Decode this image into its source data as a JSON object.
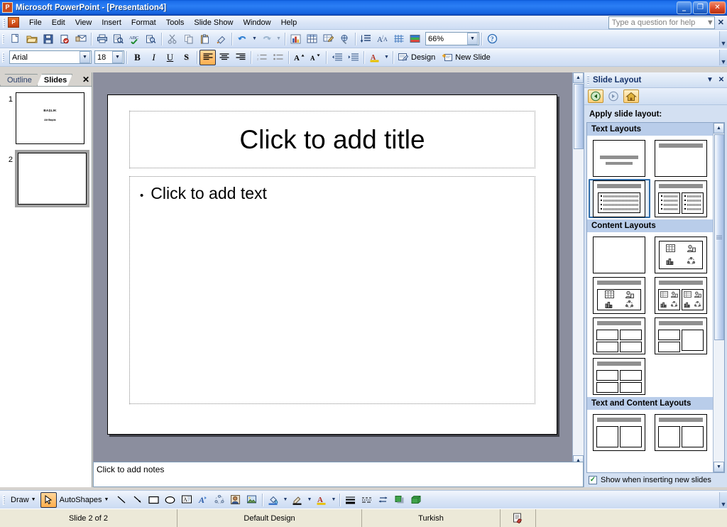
{
  "window": {
    "title": "Microsoft PowerPoint - [Presentation4]",
    "app_icon": "powerpoint-icon",
    "minimize": "_",
    "restore": "❐",
    "close": "✕"
  },
  "menubar": {
    "items": [
      {
        "label": "File"
      },
      {
        "label": "Edit"
      },
      {
        "label": "View"
      },
      {
        "label": "Insert"
      },
      {
        "label": "Format"
      },
      {
        "label": "Tools"
      },
      {
        "label": "Slide Show"
      },
      {
        "label": "Window"
      },
      {
        "label": "Help"
      }
    ]
  },
  "help_box": {
    "placeholder": "Type a question for help",
    "close": "✕"
  },
  "standard_toolbar": {
    "buttons": [
      {
        "name": "new-icon"
      },
      {
        "name": "open-icon"
      },
      {
        "name": "save-icon"
      },
      {
        "name": "permission-icon"
      },
      {
        "name": "email-icon"
      },
      {
        "name": "print-icon"
      },
      {
        "name": "print-preview-icon"
      },
      {
        "name": "spelling-icon"
      },
      {
        "name": "research-icon"
      },
      {
        "name": "cut-icon"
      },
      {
        "name": "copy-icon"
      },
      {
        "name": "paste-icon"
      },
      {
        "name": "format-painter-icon"
      },
      {
        "name": "undo-icon"
      },
      {
        "name": "redo-icon"
      },
      {
        "name": "insert-chart-icon"
      },
      {
        "name": "insert-table-icon"
      },
      {
        "name": "tables-and-borders-icon"
      },
      {
        "name": "insert-hyperlink-icon"
      },
      {
        "name": "expand-all-icon"
      },
      {
        "name": "show-formatting-icon"
      },
      {
        "name": "show-grid-icon"
      },
      {
        "name": "color-scheme-icon"
      }
    ],
    "zoom_value": "66%",
    "help_icon": "help-icon"
  },
  "formatting_toolbar": {
    "font_name": "Arial",
    "font_size": "18",
    "bold": "B",
    "italic": "I",
    "underline": "U",
    "shadow": "S",
    "align_left_active": true,
    "design_label": "Design",
    "new_slide_label": "New Slide"
  },
  "slide_panel": {
    "tabs": [
      {
        "label": "Outline",
        "selected": false
      },
      {
        "label": "Slides",
        "selected": true
      }
    ],
    "close": "✕",
    "slides": [
      {
        "number": "1",
        "selected": false,
        "title": "BAŞLIK",
        "subtitle": "Alt Başlık"
      },
      {
        "number": "2",
        "selected": true,
        "title": "",
        "subtitle": ""
      }
    ]
  },
  "slide_editor": {
    "title_placeholder": "Click to add title",
    "body_bullet": "•",
    "body_placeholder": "Click to add text"
  },
  "notes_pane": {
    "placeholder": "Click to add notes"
  },
  "task_pane": {
    "title": "Slide Layout",
    "dropdown_icon": "chevron-down-icon",
    "close": "✕",
    "nav": {
      "back": "back-icon",
      "forward": "forward-icon",
      "home": "home-icon"
    },
    "apply_label": "Apply slide layout:",
    "sections": [
      {
        "header": "Text Layouts",
        "layouts": [
          {
            "name": "title-slide",
            "kind": "title-slide",
            "selected": false
          },
          {
            "name": "title-only",
            "kind": "title-only",
            "selected": false
          },
          {
            "name": "title-and-text",
            "kind": "title-and-text",
            "selected": true
          },
          {
            "name": "title-and-2-column-text",
            "kind": "title-and-2col-text",
            "selected": false
          }
        ]
      },
      {
        "header": "Content Layouts",
        "layouts": [
          {
            "name": "blank",
            "kind": "blank",
            "selected": false
          },
          {
            "name": "content",
            "kind": "content",
            "selected": false
          },
          {
            "name": "title-and-content",
            "kind": "title-and-content",
            "selected": false
          },
          {
            "name": "title-and-two-content",
            "kind": "title-and-2content",
            "selected": false
          },
          {
            "name": "title-content-over-content",
            "kind": "title-4content-a",
            "selected": false
          },
          {
            "name": "title-two-content-and-content",
            "kind": "title-4content-b",
            "selected": false
          },
          {
            "name": "title-and-four-content",
            "kind": "title-4content-c",
            "selected": false
          }
        ]
      },
      {
        "header": "Text and Content Layouts",
        "layouts": [
          {
            "name": "title-text-and-content",
            "kind": "partial-a",
            "selected": false
          },
          {
            "name": "title-content-and-text",
            "kind": "partial-b",
            "selected": false
          }
        ]
      }
    ],
    "checkbox": {
      "label": "Show when inserting new slides",
      "checked": true,
      "mark": "✓"
    },
    "scroll_up": "▲",
    "scroll_down": "▼"
  },
  "view_buttons": [
    {
      "name": "normal-view-button",
      "selected": true
    },
    {
      "name": "slide-sorter-view-button",
      "selected": false
    },
    {
      "name": "slide-show-button",
      "selected": false
    }
  ],
  "drawing_toolbar": {
    "draw_label": "Draw",
    "autoshapes_label": "AutoShapes",
    "buttons": [
      {
        "name": "select-objects-icon",
        "active": true
      },
      {
        "name": "line-icon"
      },
      {
        "name": "arrow-icon"
      },
      {
        "name": "rectangle-icon"
      },
      {
        "name": "oval-icon"
      },
      {
        "name": "text-box-icon"
      },
      {
        "name": "insert-wordart-icon"
      },
      {
        "name": "insert-diagram-icon"
      },
      {
        "name": "insert-clip-art-icon"
      },
      {
        "name": "insert-picture-icon"
      },
      {
        "name": "fill-color-icon"
      },
      {
        "name": "line-color-icon"
      },
      {
        "name": "font-color-icon"
      },
      {
        "name": "line-style-icon"
      },
      {
        "name": "dash-style-icon"
      },
      {
        "name": "arrow-style-icon"
      },
      {
        "name": "shadow-style-icon"
      },
      {
        "name": "3d-style-icon"
      }
    ]
  },
  "status_bar": {
    "slide_counter": "Slide 2 of 2",
    "design_name": "Default Design",
    "language": "Turkish",
    "spell_icon": "spell-check-icon"
  },
  "colors": {
    "title_bar_blue": "#1b6dea",
    "toolbar_blue": "#dbe6f7",
    "task_pane_blue": "#d3e0f2",
    "section_header": "#b9cdea",
    "selection_border": "#2f6ca8",
    "status_bar": "#ece9d8",
    "slide_background_gray": "#8b8e9e"
  }
}
